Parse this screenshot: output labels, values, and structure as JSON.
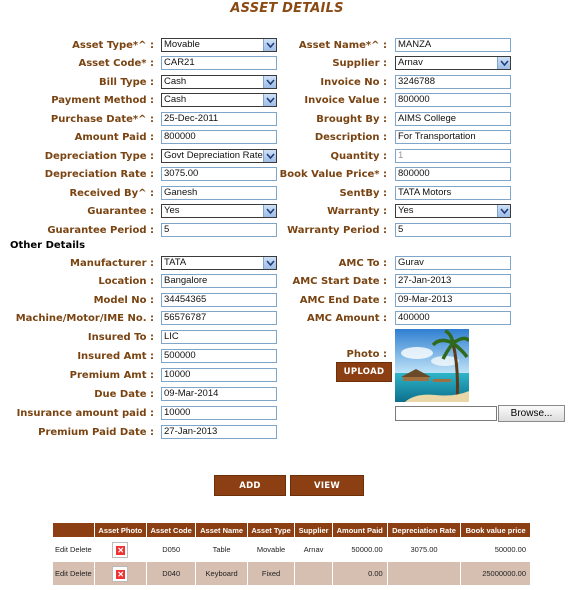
{
  "page_title": "ASSET DETAILS",
  "left_labels": [
    "Asset Type*^ :",
    "Asset Code* :",
    "Bill Type :",
    "Payment Method :",
    "Purchase Date*^ :",
    "Amount Paid :",
    "Depreciation Type :",
    "Depreciation Rate :",
    "Received By^ :",
    "Guarantee :",
    "Guarantee Period :"
  ],
  "left_values": [
    "Movable",
    "CAR21",
    "Cash",
    "Cash",
    "25-Dec-2011",
    "800000",
    "Govt Depreciation Rate",
    "3075.00",
    "Ganesh",
    "Yes",
    "5"
  ],
  "right_labels": [
    "Asset Name*^ :",
    "Supplier :",
    "Invoice No :",
    "Invoice Value :",
    "Brought By :",
    "Description :",
    "Quantity :",
    "Book Value Price* :",
    "SentBy :",
    "Warranty :",
    "Warranty Period :"
  ],
  "right_values": [
    "MANZA",
    "Arnav",
    "3246788",
    "800000",
    "AIMS College",
    "For Transportation",
    "1",
    "800000",
    "TATA Motors",
    "Yes",
    "5"
  ],
  "other_details_heading": "Other Details",
  "other_left_labels": [
    "Manufacturer :",
    "Location :",
    "Model No :",
    "Machine/Motor/IME No. :",
    "Insured To :",
    "Insured Amt :",
    "Premium Amt :",
    "Due Date :",
    "Insurance amount paid :",
    "Premium Paid Date :"
  ],
  "other_left_values": [
    "TATA",
    "Bangalore",
    "34454365",
    "56576787",
    "LIC",
    "500000",
    "10000",
    "09-Mar-2014",
    "10000",
    "27-Jan-2013"
  ],
  "other_right_labels": [
    "AMC To :",
    "AMC Start Date :",
    "AMC End Date :",
    "AMC Amount :",
    "Photo :"
  ],
  "other_right_values": [
    "Gurav",
    "27-Jan-2013",
    "09-Mar-2013",
    "400000"
  ],
  "buttons": {
    "upload": "UPLOAD",
    "browse": "Browse...",
    "add": "ADD",
    "view": "VIEW"
  },
  "table": {
    "headers": [
      "",
      "Asset Photo",
      "Asset Code",
      "Asset Name",
      "Asset Type",
      "Supplier",
      "Amount Paid",
      "Depreciation Rate",
      "Book value price"
    ],
    "rows": [
      {
        "actions": "Edit Delete",
        "code": "D050",
        "name": "Table",
        "type": "Movable",
        "supplier": "Arnav",
        "amount": "50000.00",
        "rate": "3075.00",
        "book": "50000.00"
      },
      {
        "actions": "Edit Delete",
        "code": "D040",
        "name": "Keyboard",
        "type": "Fixed",
        "supplier": "",
        "amount": "0.00",
        "rate": "",
        "book": "25000000.00"
      }
    ]
  },
  "colors": {
    "label": "#7a4412",
    "button": "#8b3f12",
    "row_alt": "#d6bfb1",
    "field_border": "#7fa6c9"
  }
}
